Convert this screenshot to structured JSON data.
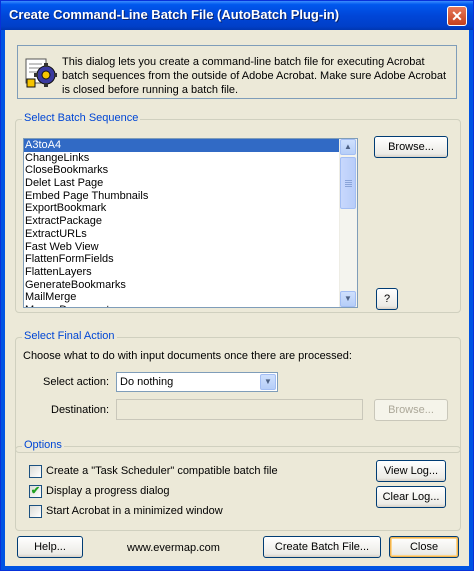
{
  "window": {
    "title": "Create Command-Line Batch File (AutoBatch Plug-in)",
    "close_glyph": "✕"
  },
  "info": {
    "text": "This dialog lets you create a command-line batch file for executing Acrobat batch sequences from the outside of Adobe Acrobat. Make sure Adobe Acrobat is closed before running a batch file."
  },
  "batch": {
    "legend": "Select Batch Sequence",
    "items": [
      "A3toA4",
      "ChangeLinks",
      "CloseBookmarks",
      "Delet Last Page",
      "Embed Page Thumbnails",
      "ExportBookmark",
      "ExtractPackage",
      "ExtractURLs",
      "Fast Web View",
      "FlattenFormFields",
      "FlattenLayers",
      "GenerateBookmarks",
      "MailMerge",
      "Merge Documents"
    ],
    "selected_index": 0,
    "browse_label": "Browse...",
    "help_label": "?"
  },
  "final": {
    "legend": "Select Final Action",
    "prompt": "Choose what to do with input documents once there are processed:",
    "action_label": "Select action:",
    "action_value": "Do nothing",
    "destination_label": "Destination:",
    "destination_value": "",
    "browse_label": "Browse..."
  },
  "options": {
    "legend": "Options",
    "task_scheduler": {
      "label": "Create a \"Task Scheduler\" compatible batch file",
      "checked": false
    },
    "progress": {
      "label": "Display a progress dialog",
      "checked": true
    },
    "minimized": {
      "label": "Start Acrobat in a minimized window",
      "checked": false
    },
    "view_log_label": "View Log...",
    "clear_log_label": "Clear Log..."
  },
  "footer": {
    "help_label": "Help...",
    "website": "www.evermap.com",
    "create_label": "Create Batch File...",
    "close_label": "Close"
  },
  "icons": {
    "check": "✔",
    "scroll_up": "▲",
    "scroll_down": "▼",
    "dropdown": "▼"
  }
}
